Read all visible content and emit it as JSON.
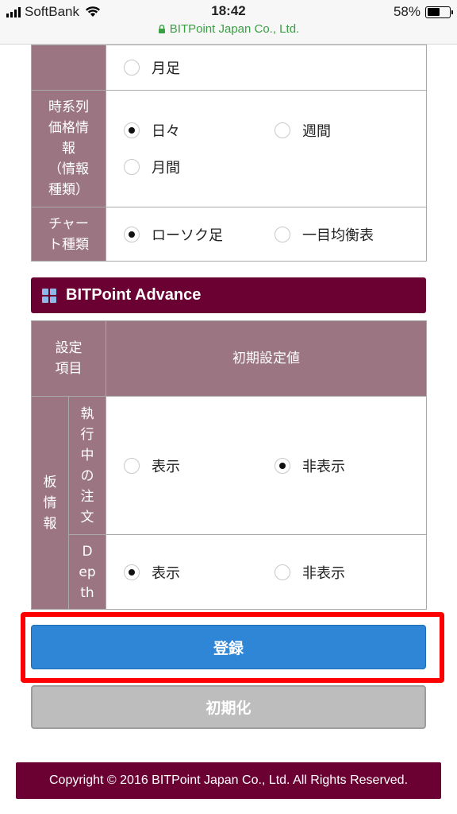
{
  "status_bar": {
    "carrier": "SoftBank",
    "time": "18:42",
    "battery": "58%",
    "battery_level": 0.58,
    "url": "BITPoint Japan Co., Ltd."
  },
  "chart_settings": {
    "rows": [
      {
        "label": "",
        "options": [
          {
            "label": "月足",
            "selected": false
          }
        ]
      },
      {
        "label": "時系列\n価格情\n報\n（情報\n種類）",
        "options": [
          {
            "label": "日々",
            "selected": true
          },
          {
            "label": "週間",
            "selected": false
          },
          {
            "label": "月間",
            "selected": false
          }
        ]
      },
      {
        "label": "チャー\nト種類",
        "options": [
          {
            "label": "ローソク足",
            "selected": true
          },
          {
            "label": "一目均衡表",
            "selected": false
          }
        ]
      }
    ]
  },
  "advance": {
    "title": "BITPoint Advance",
    "header_item": "設定\n項目",
    "header_value": "初期設定値",
    "group_label": "板\n情\n報",
    "rows": [
      {
        "label": "執\n行\n中\nの\n注\n文",
        "options": [
          {
            "label": "表示",
            "selected": false
          },
          {
            "label": "非表示",
            "selected": true
          }
        ]
      },
      {
        "label": "D\nep\nth",
        "options": [
          {
            "label": "表示",
            "selected": true
          },
          {
            "label": "非表示",
            "selected": false
          }
        ]
      }
    ]
  },
  "buttons": {
    "register": "登録",
    "reset": "初期化"
  },
  "footer": {
    "copyright": "Copyright © 2016 BITPoint Japan Co., Ltd. All Rights Reserved."
  },
  "colors": {
    "header_cell": "#9b7582",
    "brand_dark": "#6b0033",
    "primary_button": "#2f86d6",
    "highlight": "#ff0000",
    "url_green": "#3aa043"
  }
}
